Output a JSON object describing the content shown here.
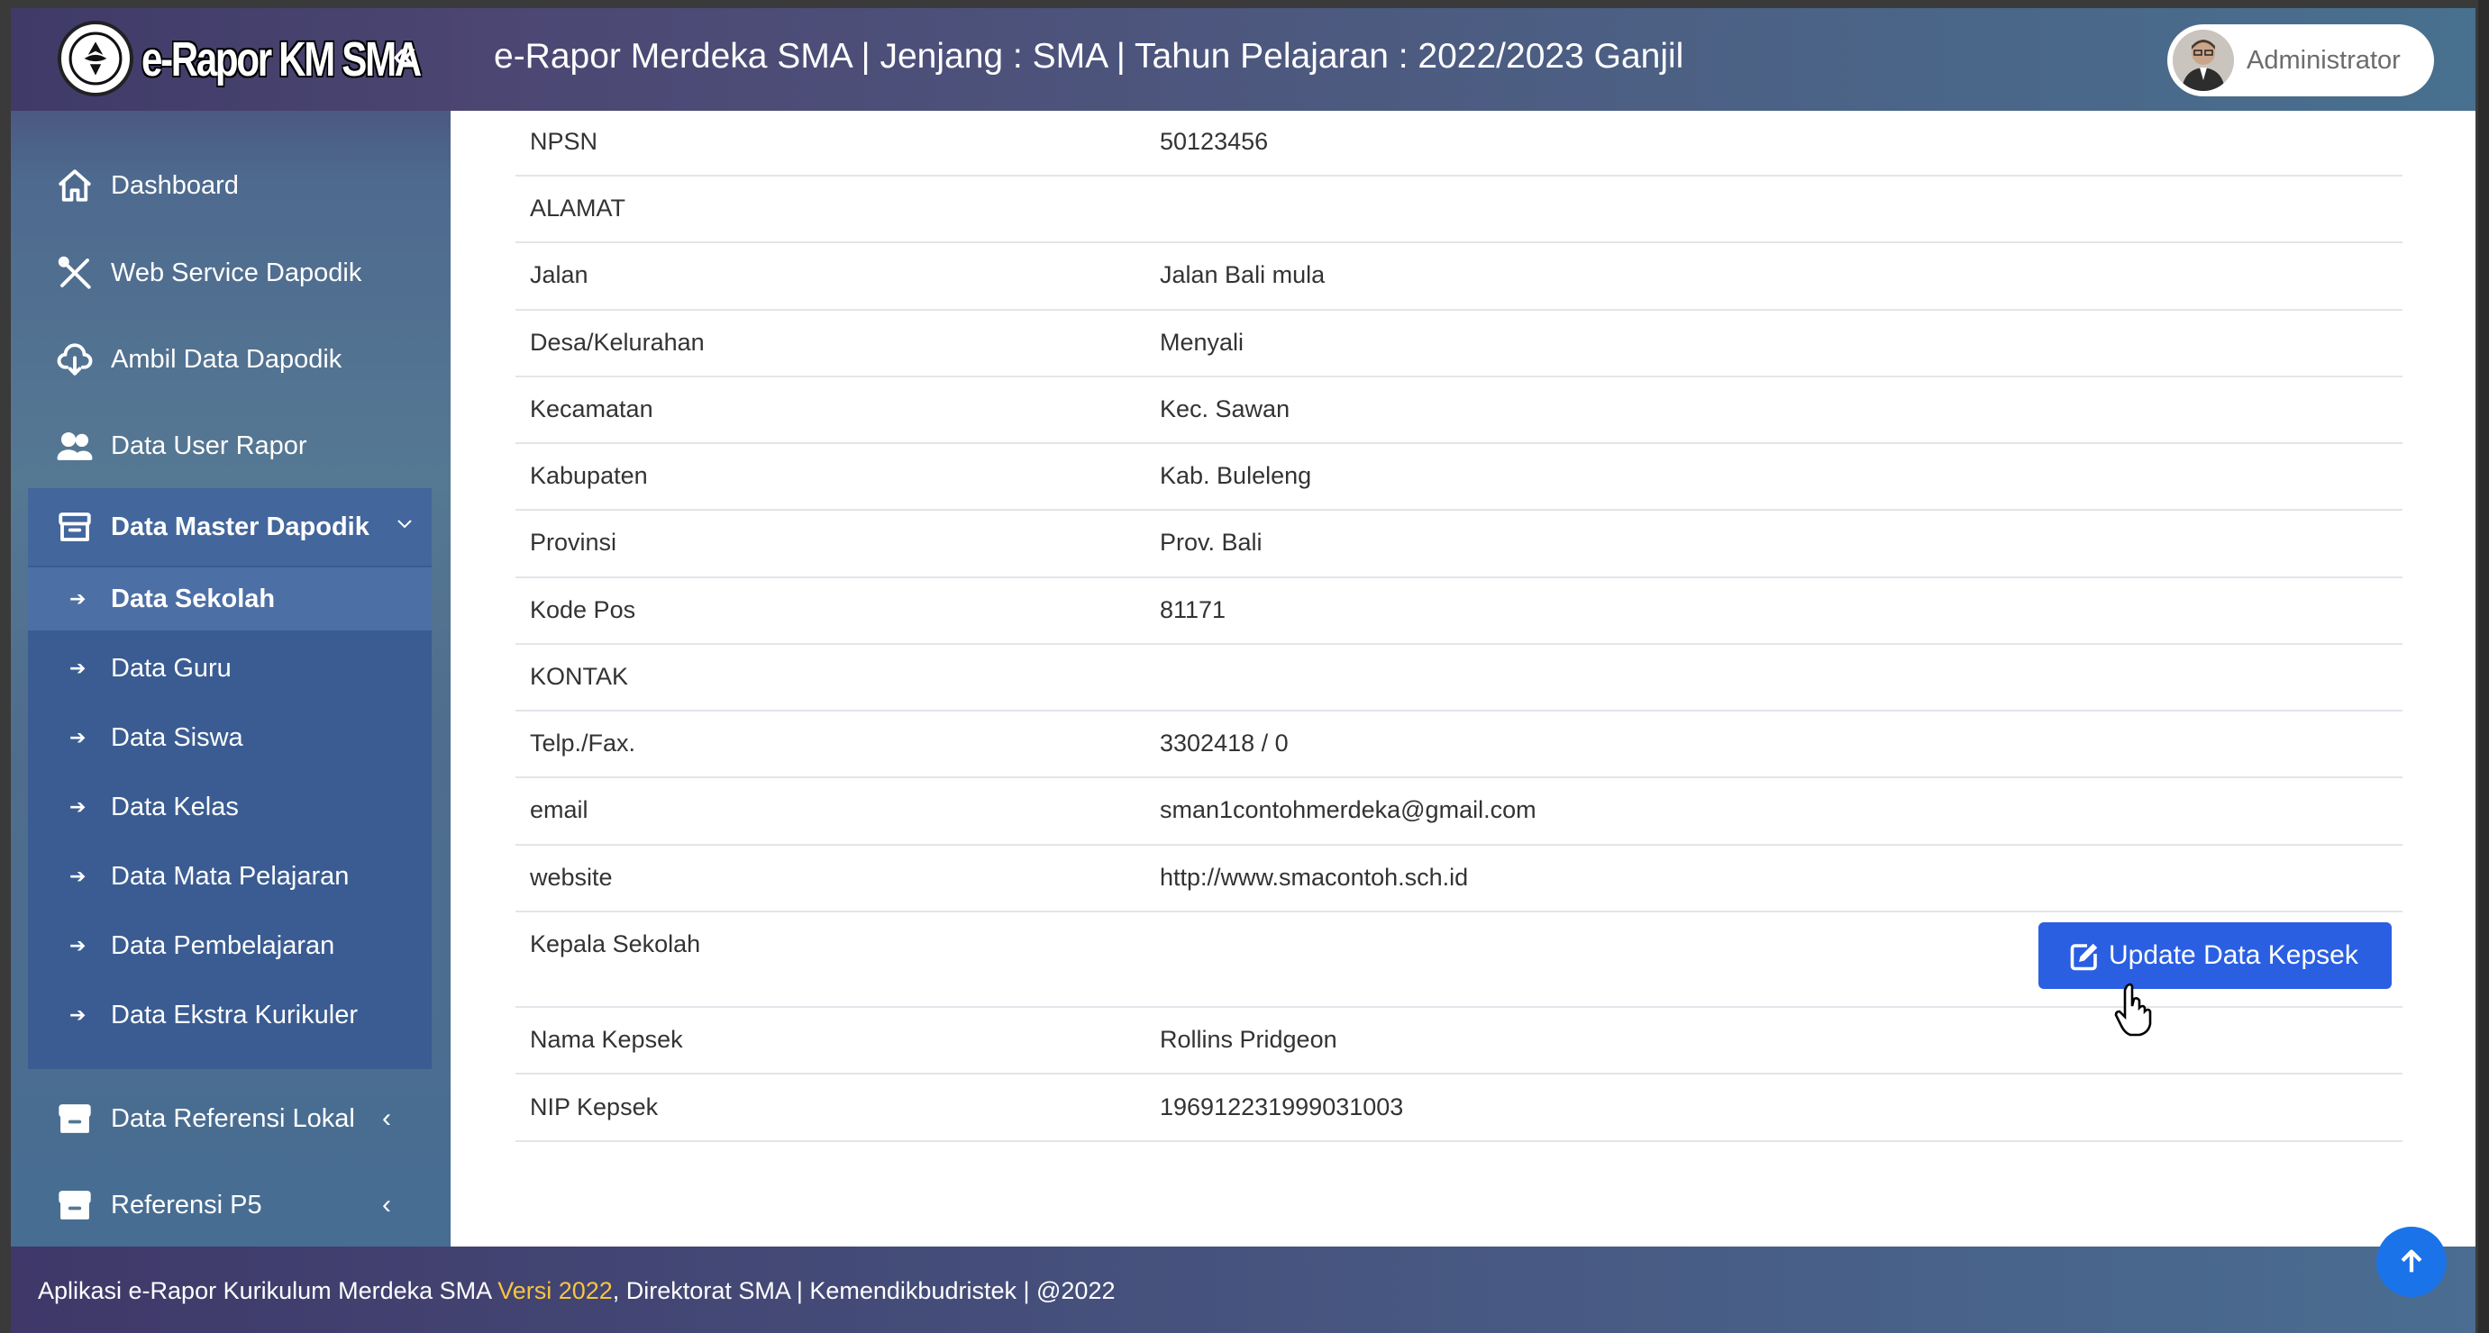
{
  "brand": {
    "logo_text": "e-Rapor KM SMA",
    "collapse_icon": "double-chevron-left-icon"
  },
  "header": {
    "title": "e-Rapor Merdeka SMA | Jenjang : SMA | Tahun Pelajaran : 2022/2023 Ganjil",
    "user_name": "Administrator"
  },
  "sidebar": {
    "items": [
      {
        "label": "Dashboard",
        "icon": "home-icon"
      },
      {
        "label": "Web Service Dapodik",
        "icon": "tools-icon"
      },
      {
        "label": "Ambil Data Dapodik",
        "icon": "cloud-download-icon"
      },
      {
        "label": "Data User Rapor",
        "icon": "users-icon"
      }
    ],
    "master": {
      "label": "Data Master Dapodik",
      "icon": "archive-icon",
      "chevron": "⌵",
      "subitems": [
        {
          "label": "Data Sekolah",
          "active": true
        },
        {
          "label": "Data Guru"
        },
        {
          "label": "Data Siswa"
        },
        {
          "label": "Data Kelas"
        },
        {
          "label": "Data Mata Pelajaran"
        },
        {
          "label": "Data Pembelajaran"
        },
        {
          "label": "Data Ekstra Kurikuler"
        }
      ]
    },
    "bottom_items": [
      {
        "label": "Data Referensi Lokal",
        "icon": "archive-icon",
        "chevron": "‹"
      },
      {
        "label": "Referensi P5",
        "icon": "archive-icon",
        "chevron": "‹"
      }
    ]
  },
  "school_info": {
    "rows": [
      {
        "key": "NPSN",
        "value": "50123456"
      },
      {
        "key": "ALAMAT",
        "value": ""
      },
      {
        "key": "Jalan",
        "value": "Jalan Bali mula"
      },
      {
        "key": "Desa/Kelurahan",
        "value": "Menyali"
      },
      {
        "key": "Kecamatan",
        "value": "Kec. Sawan"
      },
      {
        "key": "Kabupaten",
        "value": "Kab. Buleleng"
      },
      {
        "key": "Provinsi",
        "value": "Prov. Bali"
      },
      {
        "key": "Kode Pos",
        "value": "81171"
      },
      {
        "key": "KONTAK",
        "value": ""
      },
      {
        "key": "Telp./Fax.",
        "value": "3302418 / 0"
      },
      {
        "key": "email",
        "value": "sman1contohmerdeka@gmail.com"
      },
      {
        "key": "website",
        "value": "http://www.smacontoh.sch.id"
      },
      {
        "key": "Kepala Sekolah",
        "value": ""
      },
      {
        "key": "Nama Kepsek",
        "value": "Rollins Pridgeon"
      },
      {
        "key": "NIP Kepsek",
        "value": "196912231999031003"
      }
    ],
    "update_button_label": "Update Data Kepsek"
  },
  "footer": {
    "text_before": "Aplikasi e-Rapor Kurikulum Merdeka SMA ",
    "version": "Versi 2022",
    "text_after": ", Direktorat SMA | Kemendikbudristek | @2022"
  },
  "colors": {
    "primary_button": "#2a5fe2",
    "scroll_top": "#1a73e8",
    "version_text": "#f5c542"
  }
}
